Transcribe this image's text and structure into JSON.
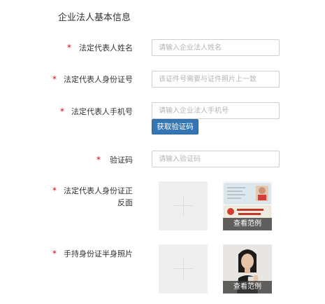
{
  "section_title": "企业法人基本信息",
  "required_mark": "*",
  "fields": {
    "legal_name": {
      "label": "法定代表人姓名",
      "placeholder": "请输入企业法人姓名"
    },
    "legal_id": {
      "label": "法定代表人身份证号",
      "placeholder": "该证件号需要与证件照片上一致"
    },
    "legal_phone": {
      "label": "法定代表人手机号",
      "placeholder": "请输入企业法人手机号"
    },
    "verify_code": {
      "label": "验证码",
      "placeholder": "请输入验证码"
    }
  },
  "get_code_button": "获取验证码",
  "uploads": {
    "id_card": {
      "label_line1": "法定代表人身份证正",
      "label_line2": "反面",
      "sample_caption": "查看范例"
    },
    "handheld": {
      "label": "手持身份证半身照片",
      "sample_caption": "查看范例"
    }
  },
  "icons": {
    "upload": "plus-icon"
  }
}
